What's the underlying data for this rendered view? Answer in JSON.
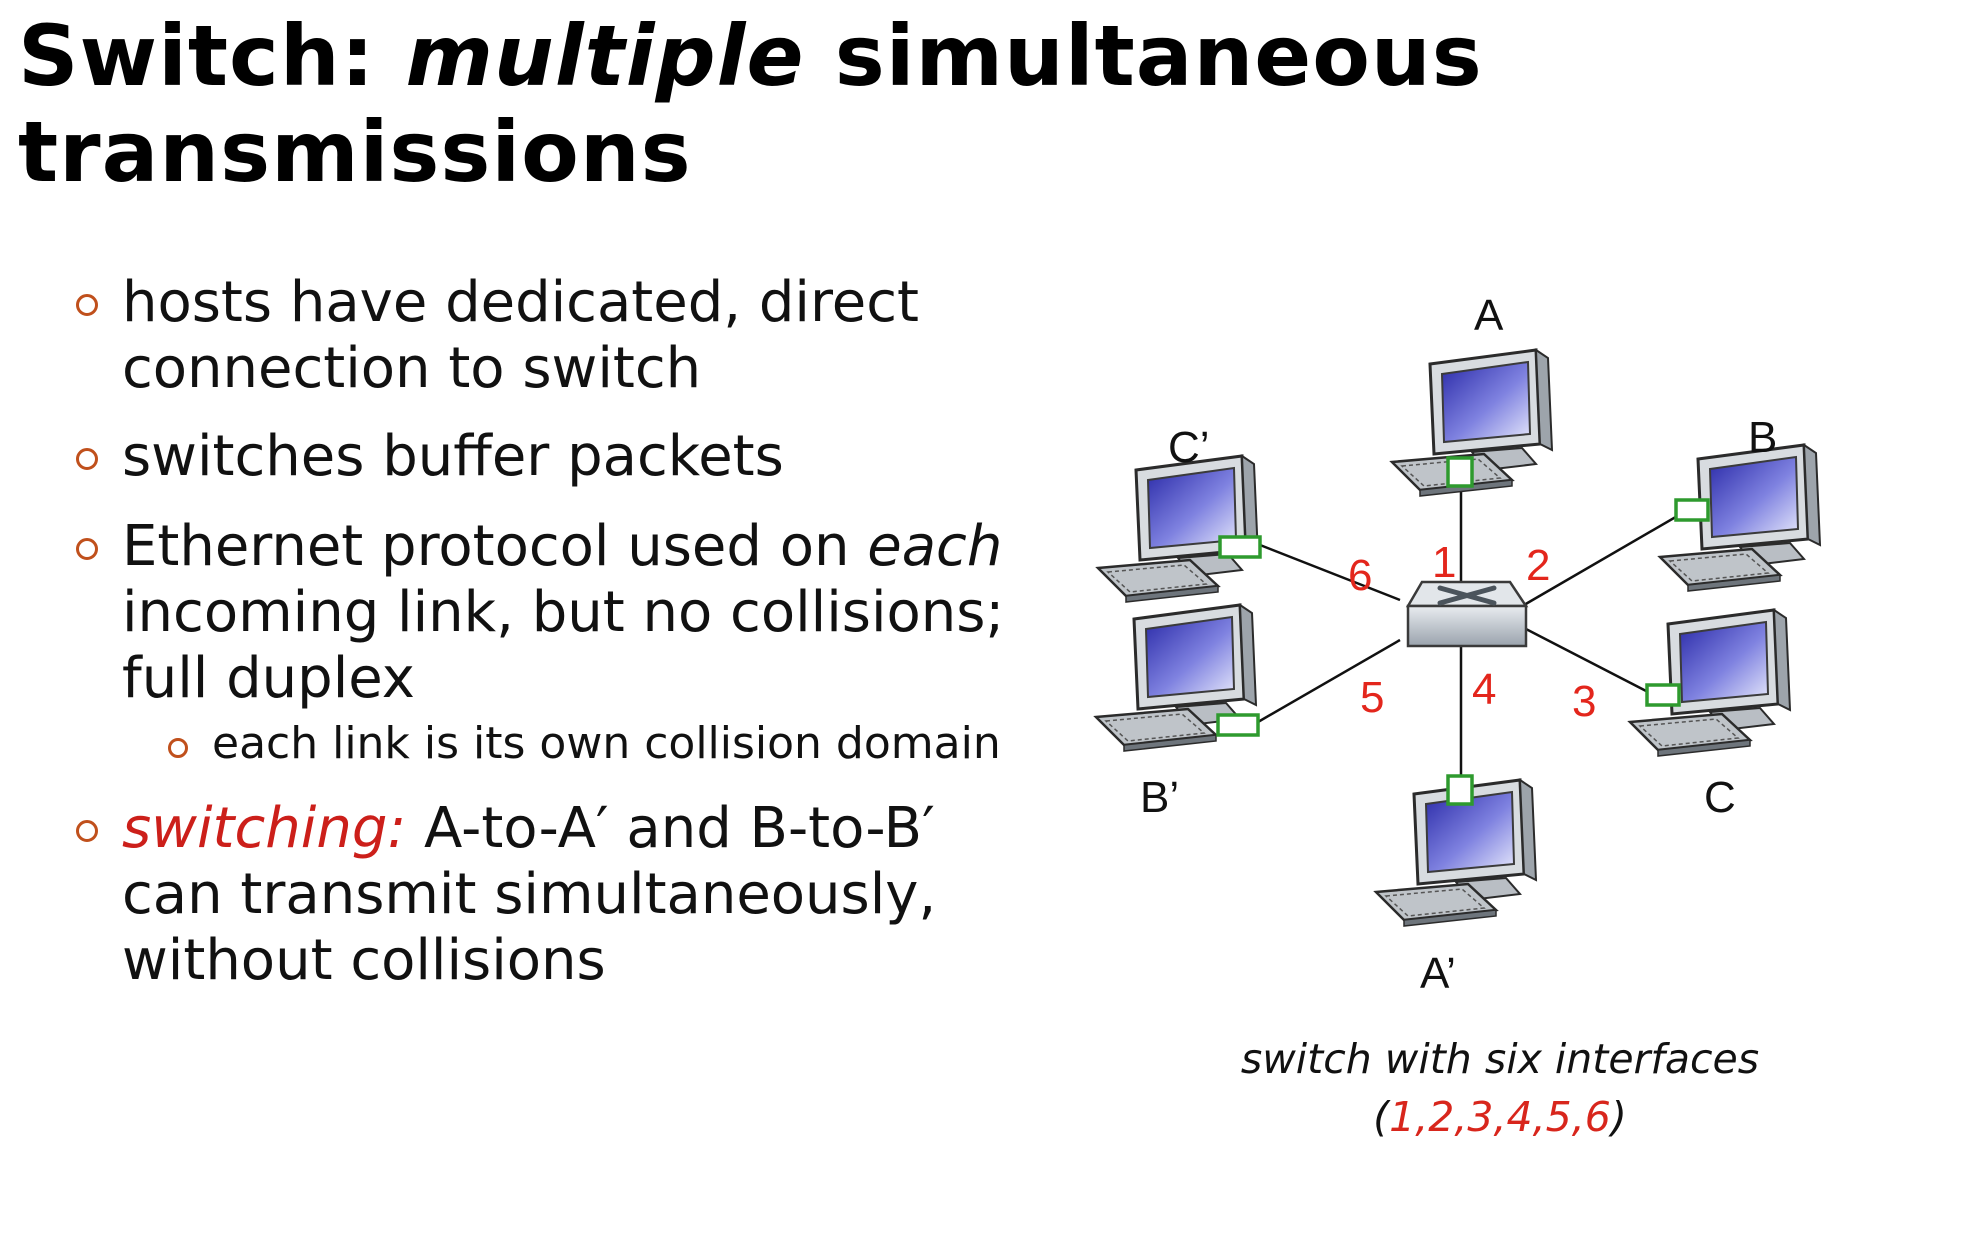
{
  "title": {
    "prefix": "Switch: ",
    "emphasis": "multiple",
    "suffix": " simultaneous transmissions"
  },
  "bullets": [
    {
      "text": "hosts have dedicated, direct connection to switch"
    },
    {
      "text": "switches buffer packets"
    },
    {
      "pre": "Ethernet protocol used on ",
      "em": "each",
      "post": " incoming link, but no collisions; full duplex"
    },
    {
      "sub": "each link is its own collision domain"
    },
    {
      "red": "switching:",
      "post": " A-to-A′ and B-to-B′ can transmit simultaneously, without collisions"
    }
  ],
  "diagram": {
    "hosts": {
      "A": "A",
      "B": "B",
      "C": "C",
      "A2": "A’",
      "B2": "B’",
      "C2": "C’"
    },
    "interfaces": [
      "1",
      "2",
      "3",
      "4",
      "5",
      "6"
    ],
    "caption_line1": "switch with six interfaces",
    "caption_open": "(",
    "caption_nums": "1,2,3,4,5,6",
    "caption_close": ")"
  },
  "colors": {
    "accent_red": "#cc1f1a",
    "bullet_marker": "#c0501c",
    "interface_green": "#2e9a2e"
  }
}
